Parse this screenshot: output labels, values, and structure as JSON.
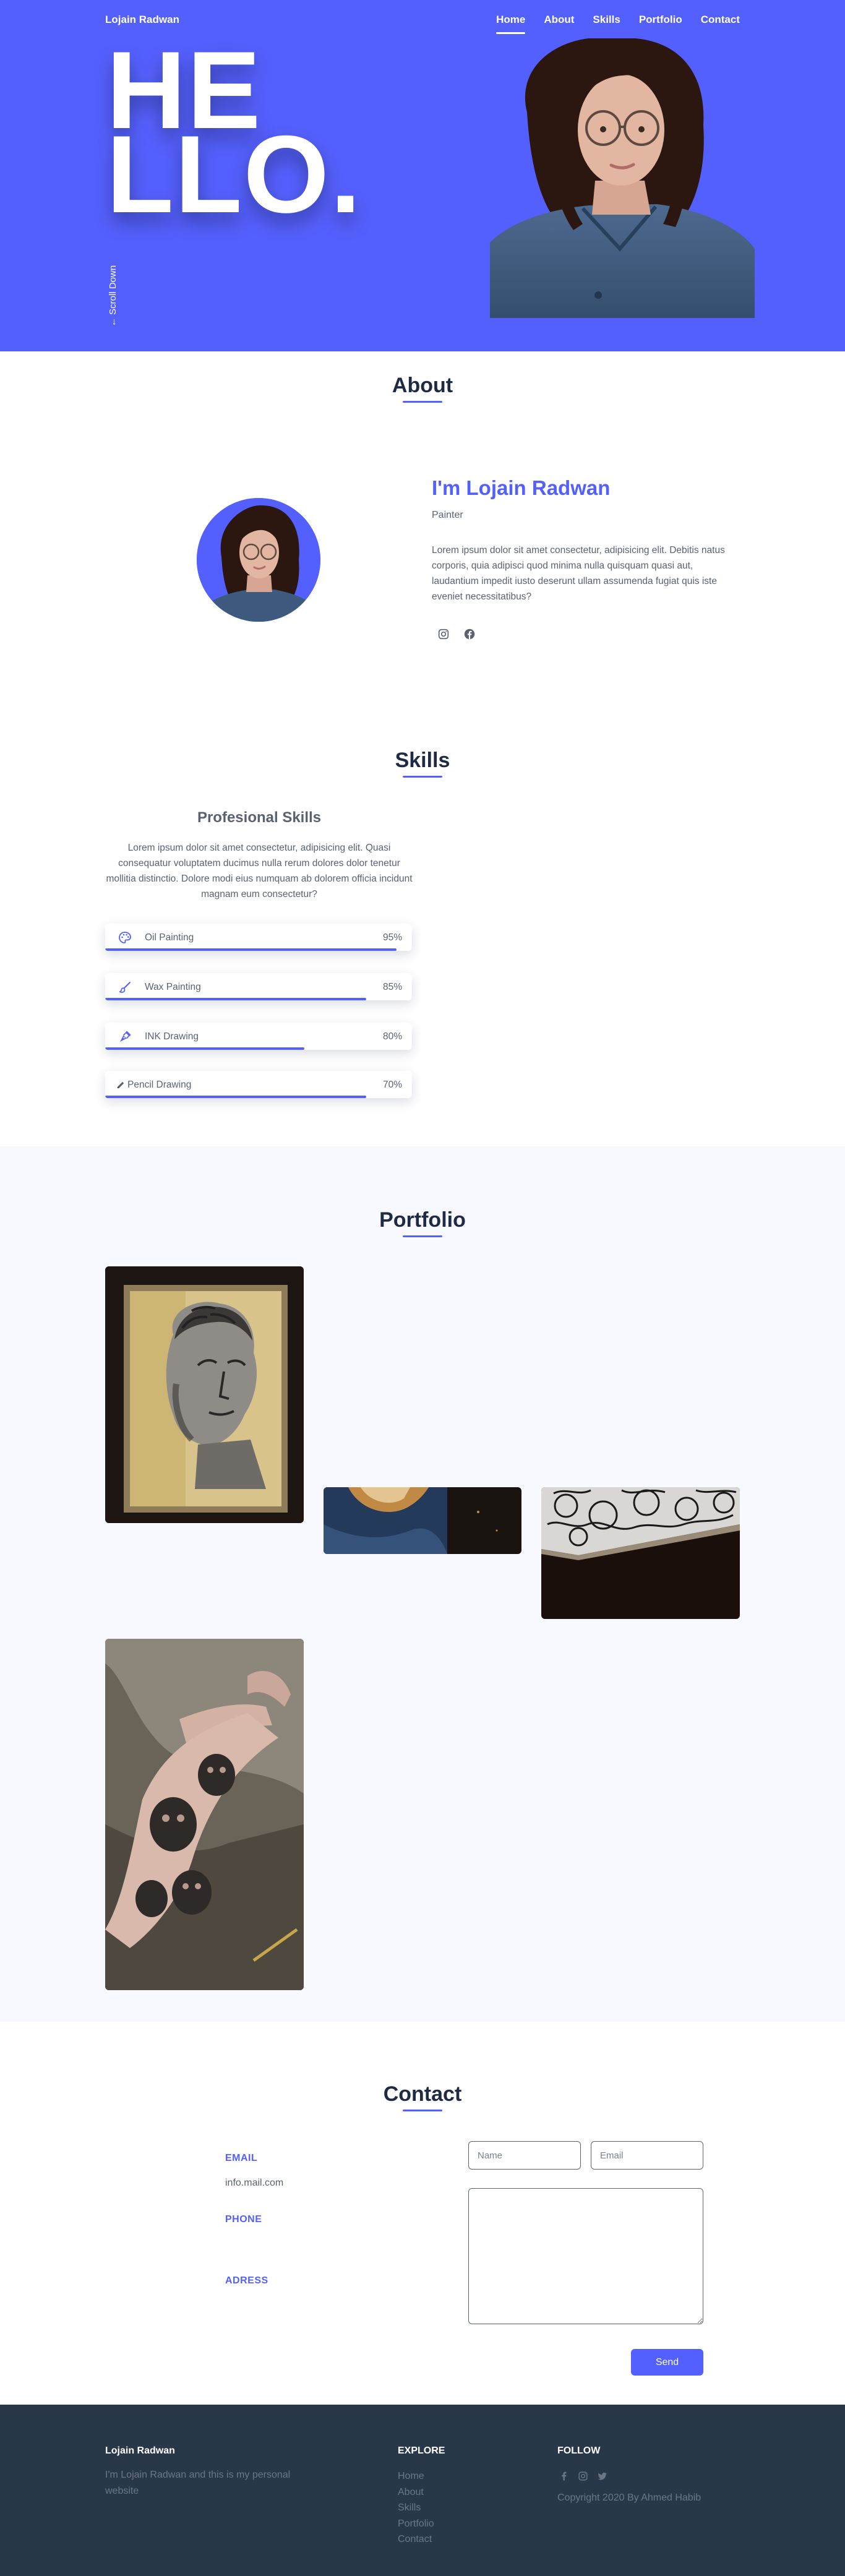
{
  "colors": {
    "accent": "#5460fd",
    "heading": "#1f2a44",
    "text": "#5a6272",
    "footer_bg": "#293849",
    "portfolio_bg": "#f8f8ff"
  },
  "header": {
    "brand": "Lojain Radwan",
    "nav": [
      {
        "label": "Home",
        "active": true
      },
      {
        "label": "About",
        "active": false
      },
      {
        "label": "Skills",
        "active": false
      },
      {
        "label": "Portfolio",
        "active": false
      },
      {
        "label": "Contact",
        "active": false
      }
    ]
  },
  "hero": {
    "hello_line1": "HE",
    "hello_line2": "LLO.",
    "scroll_label": "← Scroll Down",
    "photo_icon": "portrait-photo"
  },
  "about": {
    "title": "About",
    "name": "I'm Lojain Radwan",
    "role": "Painter",
    "text": "Lorem ipsum dolor sit amet consectetur, adipisicing elit. Debitis natus corporis, quia adipisci quod minima nulla quisquam quasi aut, laudantium impedit iusto deserunt ullam assumenda fugiat quis iste eveniet necessitatibus?",
    "socials": [
      "instagram-icon",
      "facebook-icon"
    ]
  },
  "skills": {
    "title": "Skills",
    "subtitle": "Profesional Skills",
    "text": "Lorem ipsum dolor sit amet consectetur, adipisicing elit. Quasi consequatur voluptatem ducimus nulla rerum dolores dolor tenetur mollitia distinctio. Dolore modi eius numquam ab dolorem officia incidunt magnam eum consectetur?",
    "items": [
      {
        "name": "Oil Painting",
        "percent": "95%",
        "level": 0.95,
        "icon": "palette-icon"
      },
      {
        "name": "Wax Painting",
        "percent": "85%",
        "level": 0.85,
        "icon": "paint-brush-icon"
      },
      {
        "name": "INK Drawing",
        "percent": "80%",
        "level": 0.65,
        "icon": "pen-nib-icon"
      },
      {
        "name": "Pencil Drawing",
        "percent": "70%",
        "level": 0.85,
        "icon": "pencil-icon"
      }
    ]
  },
  "portfolio": {
    "title": "Portfolio",
    "items": [
      {
        "name": "portfolio-item-statue-drawing",
        "icon": "sketch-artwork"
      },
      {
        "name": "portfolio-item-blue-painting",
        "icon": "painting-artwork"
      },
      {
        "name": "portfolio-item-ink-pattern",
        "icon": "ink-artwork"
      },
      {
        "name": "portfolio-item-arm-tattoo",
        "icon": "tattoo-photo"
      }
    ]
  },
  "contact": {
    "title": "Contact",
    "email_label": "EMAIL",
    "email_value": "info.mail.com",
    "phone_label": "PHONE",
    "address_label": "ADRESS",
    "name_placeholder": "Name",
    "email_placeholder": "Email",
    "send_label": "Send"
  },
  "footer": {
    "brand": "Lojain Radwan",
    "about_text": "I'm Lojain Radwan and this is my personal website",
    "explore_title": "EXPLORE",
    "explore_links": [
      "Home",
      "About",
      "Skills",
      "Portfolio",
      "Contact"
    ],
    "follow_title": "FOLLOW",
    "follow_icons": [
      "facebook-icon",
      "instagram-icon",
      "twitter-icon"
    ],
    "copyright": "Copyright 2020 By Ahmed Habib"
  }
}
